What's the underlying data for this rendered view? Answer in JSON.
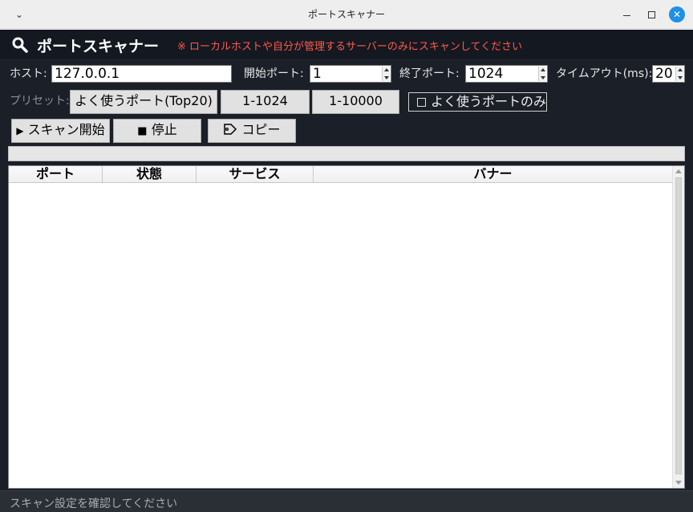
{
  "window": {
    "title": "ポートスキャナー"
  },
  "header": {
    "title": "ポートスキャナー",
    "warning": "※ ローカルホストや自分が管理するサーバーのみにスキャンしてください"
  },
  "form": {
    "host_label": "ホスト:",
    "host_value": "127.0.0.1",
    "start_port_label": "開始ポート:",
    "start_port_value": "1",
    "end_port_label": "終了ポート:",
    "end_port_value": "1024",
    "timeout_label": "タイムアウト(ms):",
    "timeout_value": "20"
  },
  "presets": {
    "label": "プリセット:",
    "buttons": [
      "よく使うポート(Top20)",
      "1-1024",
      "1-10000"
    ],
    "common_only_label": "よく使うポートのみ",
    "common_only_checked": false
  },
  "actions": {
    "start_label": "スキャン開始",
    "stop_label": "停止",
    "copy_label": "コピー"
  },
  "progress": {
    "value": 0
  },
  "table": {
    "columns": [
      "ポート",
      "状態",
      "サービス",
      "バナー"
    ],
    "rows": []
  },
  "status": {
    "text": "スキャン設定を確認してください"
  }
}
